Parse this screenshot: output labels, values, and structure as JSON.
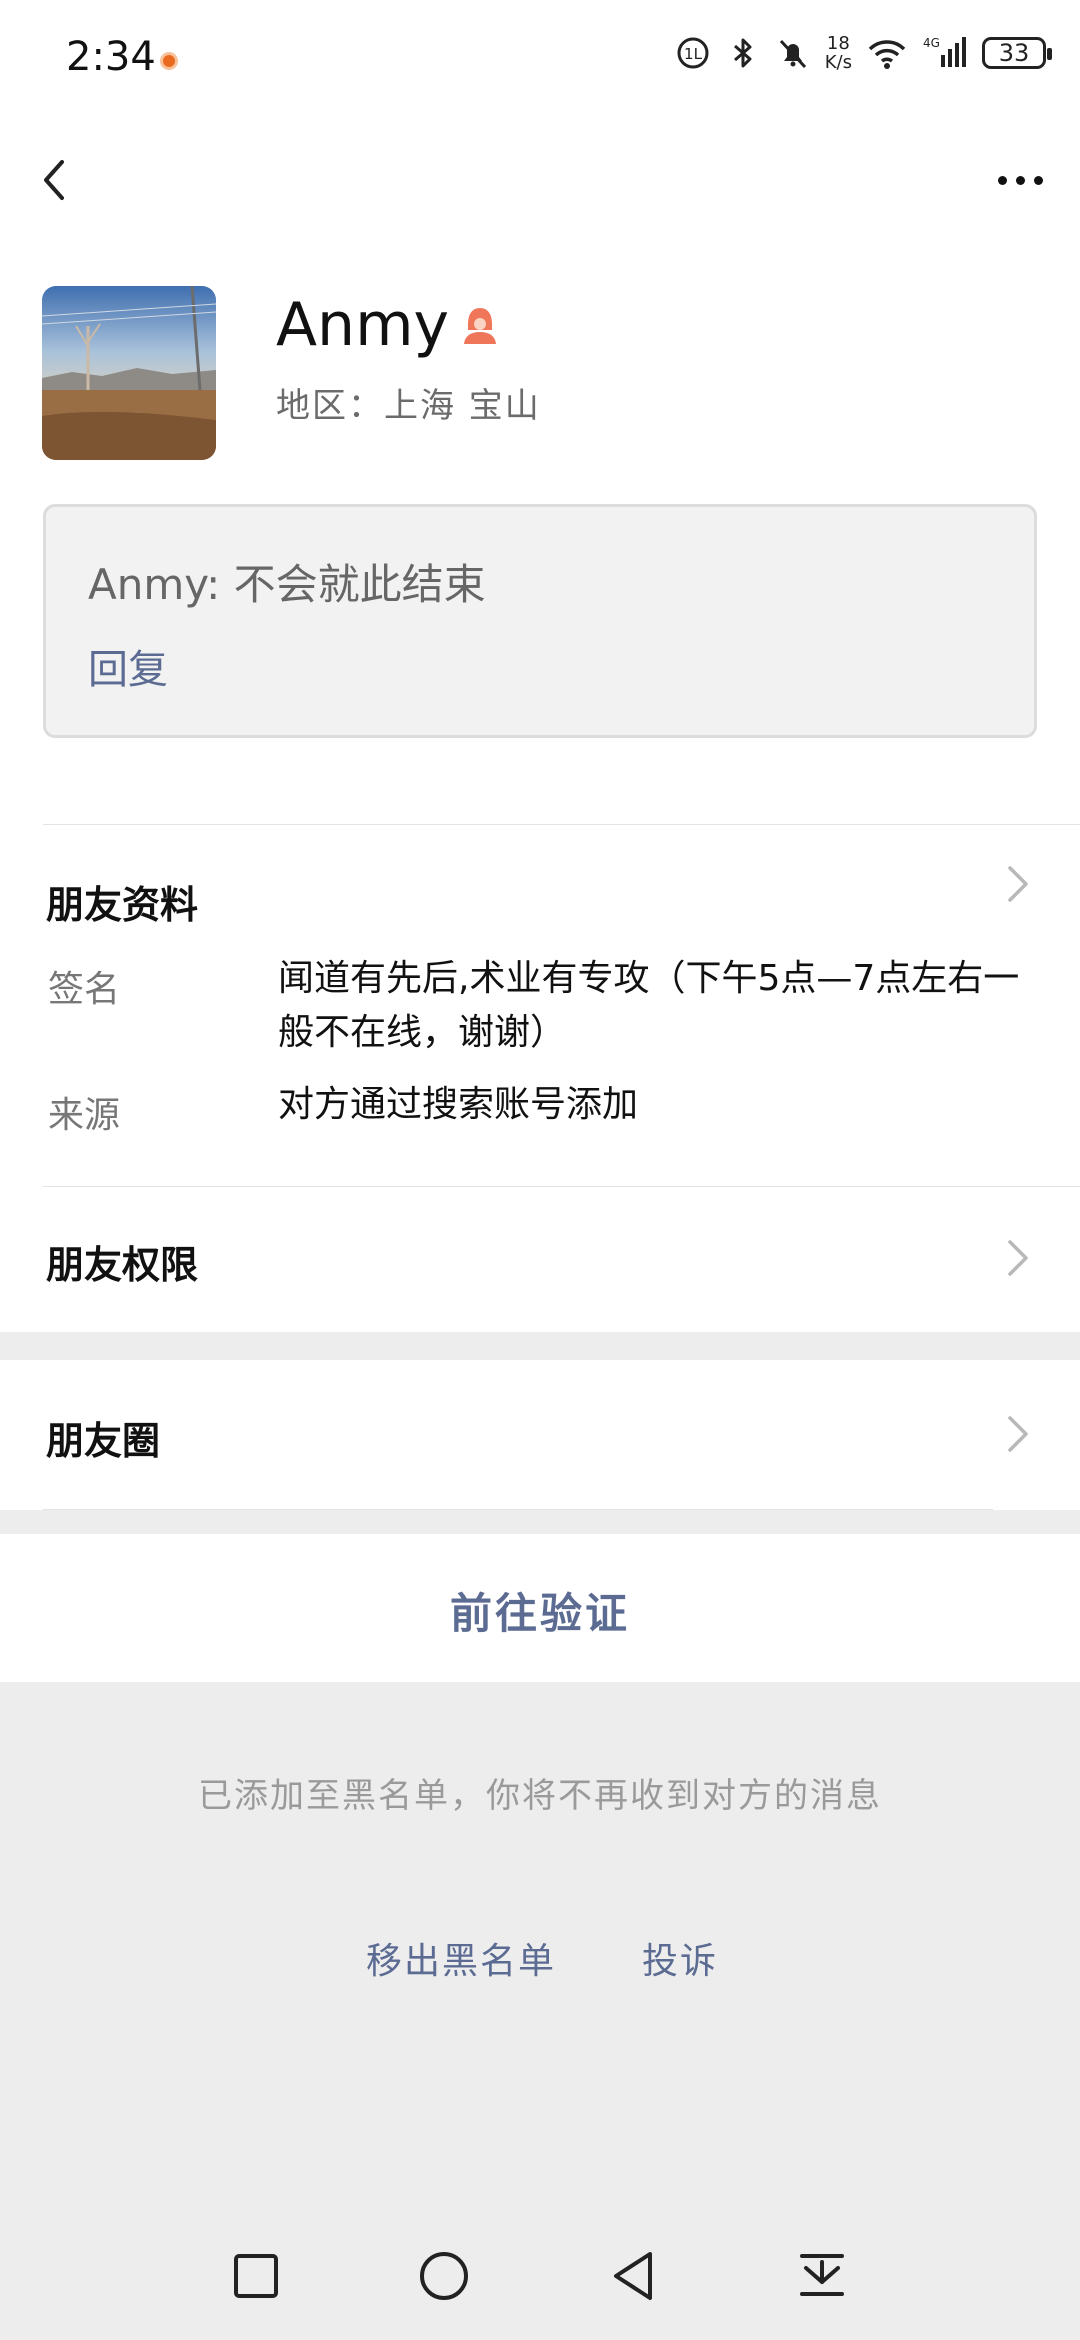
{
  "status_bar": {
    "time": "2:34",
    "net_speed_value": "18",
    "net_speed_unit": "K/s",
    "network": "4G",
    "battery": "33"
  },
  "profile": {
    "name": "Anmy",
    "region": "地区：上海 宝山",
    "gender_icon": "female-icon"
  },
  "moment_reply": {
    "text": "Anmy: 不会就此结束",
    "reply_label": "回复"
  },
  "friend_info": {
    "title": "朋友资料",
    "rows": [
      {
        "label": "签名",
        "value": "闻道有先后,术业有专攻（下午5点—7点左右一般不在线，谢谢）"
      },
      {
        "label": "来源",
        "value": "对方通过搜索账号添加"
      }
    ]
  },
  "friend_permissions": {
    "title": "朋友权限"
  },
  "moments": {
    "title": "朋友圈"
  },
  "verify": {
    "label": "前往验证"
  },
  "blacklist": {
    "note": "已添加至黑名单，你将不再收到对方的消息",
    "remove_label": "移出黑名单",
    "report_label": "投诉"
  },
  "colors": {
    "link_blue": "#5b6b92",
    "background": "#ededed",
    "gender_female": "#f0765a"
  }
}
